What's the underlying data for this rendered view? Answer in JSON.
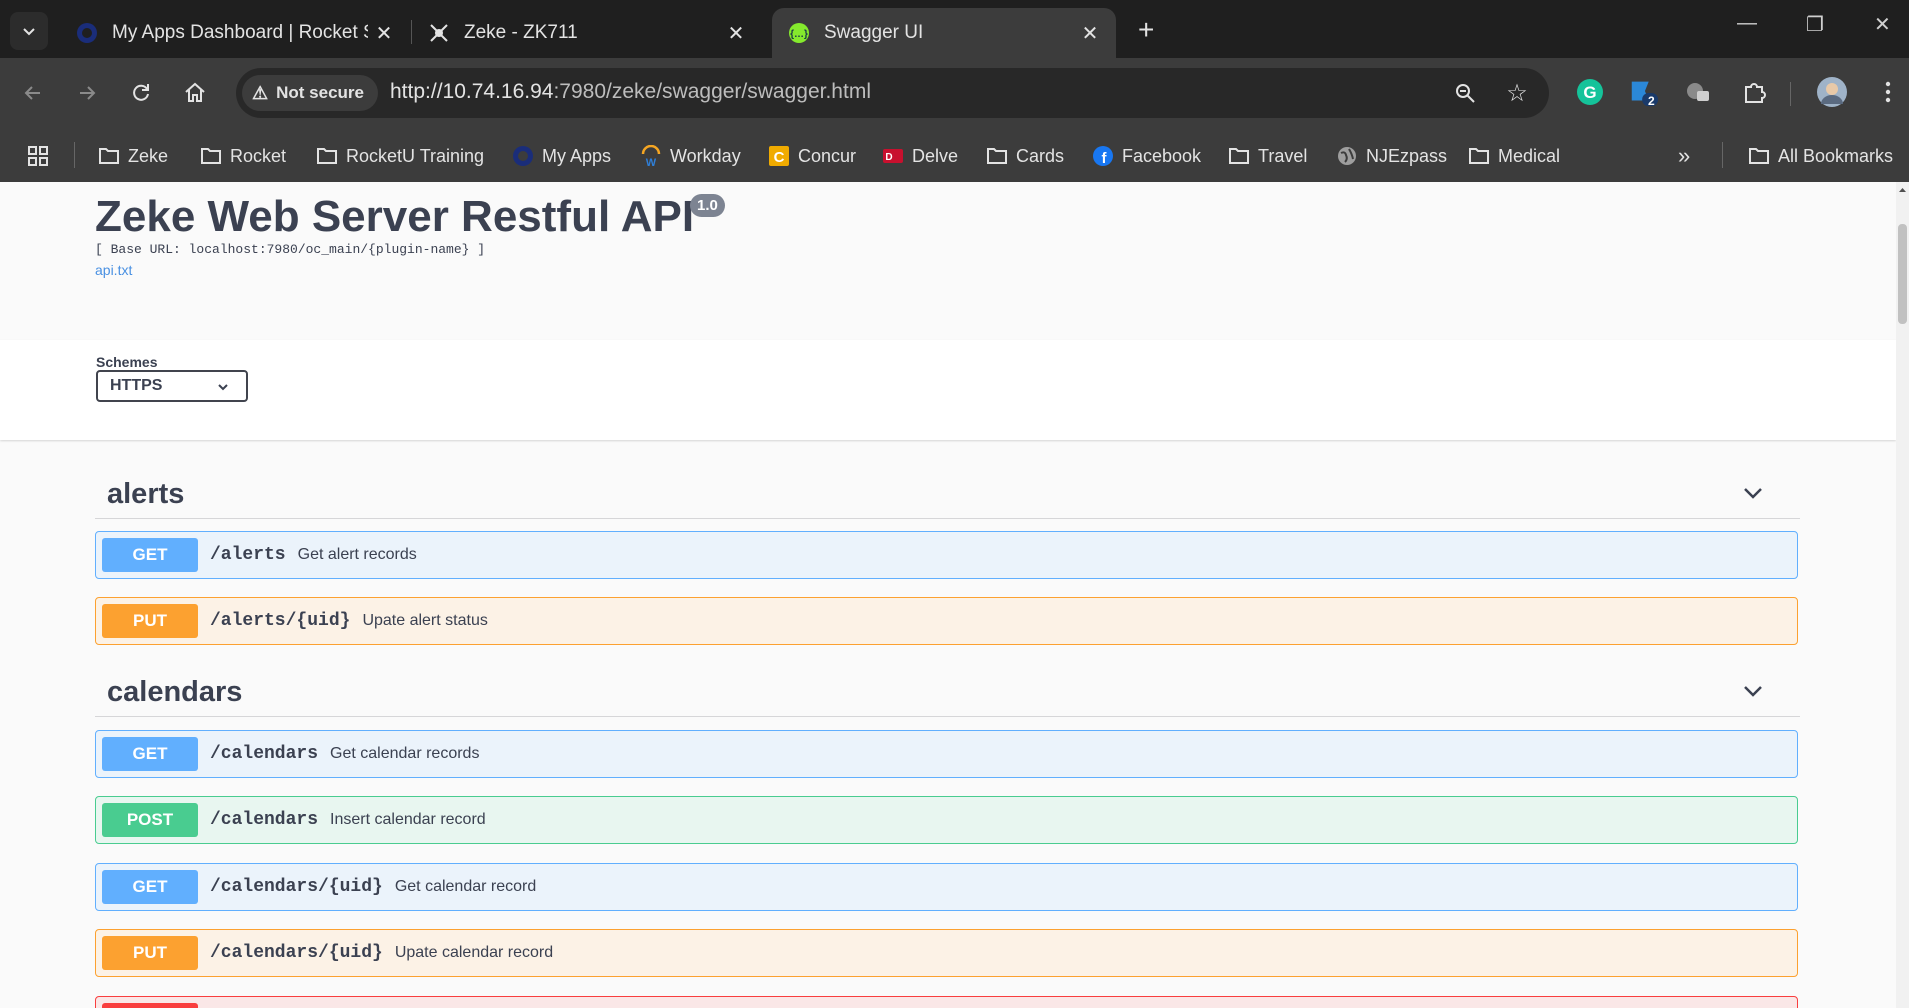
{
  "tabs": [
    {
      "title": "My Apps Dashboard | Rocket So",
      "icon": "rocket-logo-icon",
      "active": false
    },
    {
      "title": "Zeke - ZK711",
      "icon": "zeke-logo-icon",
      "active": false
    },
    {
      "title": "Swagger UI",
      "icon": "swagger-logo-icon",
      "active": true
    }
  ],
  "toolbar": {
    "security_label": "Not secure",
    "url_host": "http://10.74.16.94",
    "url_rest": ":7980/zeke/swagger/swagger.html",
    "extension_badge": "2"
  },
  "bookmarks": [
    {
      "label": "Zeke",
      "icon": "folder-icon"
    },
    {
      "label": "Rocket",
      "icon": "folder-icon"
    },
    {
      "label": "RocketU Training",
      "icon": "folder-icon"
    },
    {
      "label": "My Apps",
      "icon": "rocket-logo-icon"
    },
    {
      "label": "Workday",
      "icon": "workday-logo-icon"
    },
    {
      "label": "Concur",
      "icon": "concur-logo-icon"
    },
    {
      "label": "Delve",
      "icon": "delve-logo-icon"
    },
    {
      "label": "Cards",
      "icon": "folder-icon"
    },
    {
      "label": "Facebook",
      "icon": "facebook-logo-icon"
    },
    {
      "label": "Travel",
      "icon": "folder-icon"
    },
    {
      "label": "NJEzpass",
      "icon": "globe-icon"
    },
    {
      "label": "Medical",
      "icon": "folder-icon"
    }
  ],
  "all_bookmarks_label": "All Bookmarks",
  "info": {
    "title": "Zeke Web Server Restful API",
    "version": "1.0",
    "base_url": "[ Base URL: localhost:7980/oc_main/{plugin-name} ]",
    "link": "api.txt"
  },
  "schemes": {
    "label": "Schemes",
    "selected": "HTTPS"
  },
  "sections": [
    {
      "name": "alerts",
      "operations": [
        {
          "method": "GET",
          "path": "/alerts",
          "summary": "Get alert records"
        },
        {
          "method": "PUT",
          "path": "/alerts/{uid}",
          "summary": "Upate alert status"
        }
      ]
    },
    {
      "name": "calendars",
      "operations": [
        {
          "method": "GET",
          "path": "/calendars",
          "summary": "Get calendar records"
        },
        {
          "method": "POST",
          "path": "/calendars",
          "summary": "Insert calendar record"
        },
        {
          "method": "GET",
          "path": "/calendars/{uid}",
          "summary": "Get calendar record"
        },
        {
          "method": "PUT",
          "path": "/calendars/{uid}",
          "summary": "Upate calendar record"
        },
        {
          "method": "",
          "path": "",
          "summary": ""
        }
      ]
    }
  ]
}
